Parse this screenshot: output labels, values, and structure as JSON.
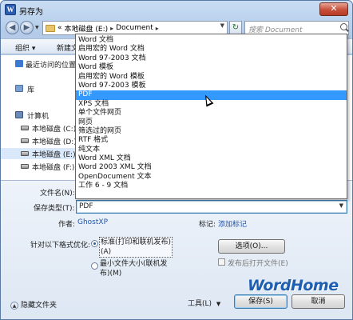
{
  "window": {
    "title": "另存为",
    "close_label": "✕"
  },
  "address": {
    "crumbs": [
      "«",
      "本地磁盘 (E:)",
      "Document"
    ],
    "search_placeholder": "搜索 Document"
  },
  "toolbar": {
    "organize": "组织 ▾",
    "new_folder": "新建文件夹"
  },
  "sidebar": {
    "items": [
      {
        "label": "最近访问的位置",
        "icon": "recent-icon"
      },
      {
        "label": "库",
        "icon": "library-icon"
      },
      {
        "label": "计算机",
        "icon": "computer-icon"
      },
      {
        "label": "本地磁盘 (C:)",
        "icon": "drive-icon"
      },
      {
        "label": "本地磁盘 (D:)",
        "icon": "drive-icon"
      },
      {
        "label": "本地磁盘 (E:)",
        "icon": "drive-icon"
      },
      {
        "label": "本地磁盘 (F:)",
        "icon": "drive-icon"
      }
    ]
  },
  "form": {
    "filename_label": "文件名(N):",
    "filename_value": "",
    "type_label": "保存类型(T):",
    "type_value": "PDF",
    "author_label": "作者:",
    "author_value": "GhostXP",
    "tags_label": "标记:",
    "tags_value": "添加标记",
    "optimize_label": "针对以下格式优化:",
    "option_standard_line1": "标准(打印和联机发布)",
    "option_standard_line2": "(A)",
    "option_minimum_line1": "最小文件大小(联机发",
    "option_minimum_line2": "布)(M)",
    "options_button": "选项(O)...",
    "open_after_label": "发布后打开文件(E)"
  },
  "footer": {
    "hide_folders": "隐藏文件夹",
    "tools": "工具(L)",
    "save": "保存(S)",
    "cancel": "取消"
  },
  "dropdown": {
    "selected": "PDF",
    "items": [
      "Word 文档",
      "启用宏的 Word 文档",
      "Word 97-2003 文档",
      "Word 模板",
      "启用宏的 Word 模板",
      "Word 97-2003 模板",
      "PDF",
      "XPS 文档",
      "单个文件网页",
      "网页",
      "筛选过的网页",
      "RTF 格式",
      "纯文本",
      "Word XML 文档",
      "Word 2003 XML 文档",
      "OpenDocument 文本",
      "工作 6 - 9 文档"
    ]
  },
  "watermark": "WordHome"
}
